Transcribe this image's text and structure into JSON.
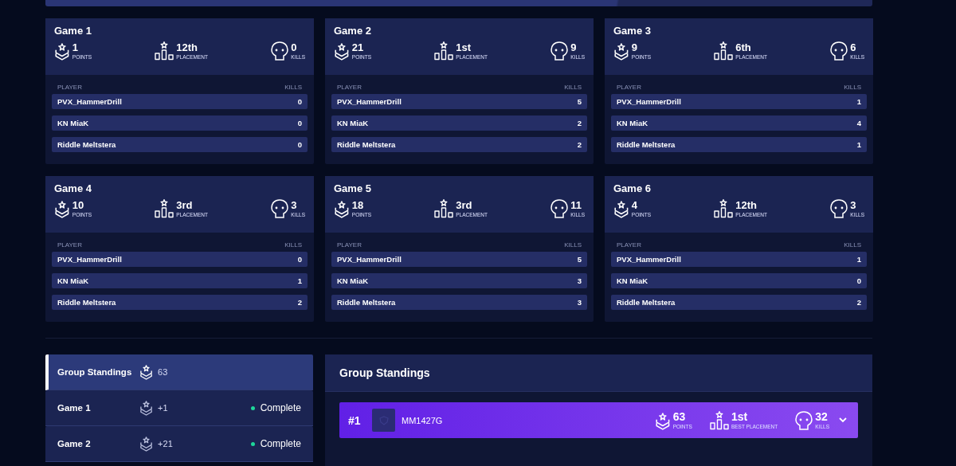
{
  "games": [
    {
      "title": "Game 1",
      "stats": [
        {
          "kind": "points",
          "value": "1",
          "label": "POINTS"
        },
        {
          "kind": "placement",
          "value": "12th",
          "label": "PLACEMENT"
        },
        {
          "kind": "kills",
          "value": "0",
          "label": "KILLS"
        }
      ],
      "columns": [
        "PLAYER",
        "KILLS"
      ],
      "rows": [
        {
          "player": "PVX_HammerDrill",
          "kills": "0"
        },
        {
          "player": "KN MiaK",
          "kills": "0"
        },
        {
          "player": "Riddle Meltstera",
          "kills": "0"
        }
      ]
    },
    {
      "title": "Game 2",
      "stats": [
        {
          "kind": "points",
          "value": "21",
          "label": "POINTS"
        },
        {
          "kind": "placement",
          "value": "1st",
          "label": "PLACEMENT"
        },
        {
          "kind": "kills",
          "value": "9",
          "label": "KILLS"
        }
      ],
      "columns": [
        "PLAYER",
        "KILLS"
      ],
      "rows": [
        {
          "player": "PVX_HammerDrill",
          "kills": "5"
        },
        {
          "player": "KN MiaK",
          "kills": "2"
        },
        {
          "player": "Riddle Meltstera",
          "kills": "2"
        }
      ]
    },
    {
      "title": "Game 3",
      "stats": [
        {
          "kind": "points",
          "value": "9",
          "label": "POINTS"
        },
        {
          "kind": "placement",
          "value": "6th",
          "label": "PLACEMENT"
        },
        {
          "kind": "kills",
          "value": "6",
          "label": "KILLS"
        }
      ],
      "columns": [
        "PLAYER",
        "KILLS"
      ],
      "rows": [
        {
          "player": "PVX_HammerDrill",
          "kills": "1"
        },
        {
          "player": "KN MiaK",
          "kills": "4"
        },
        {
          "player": "Riddle Meltstera",
          "kills": "1"
        }
      ]
    },
    {
      "title": "Game 4",
      "stats": [
        {
          "kind": "points",
          "value": "10",
          "label": "POINTS"
        },
        {
          "kind": "placement",
          "value": "3rd",
          "label": "PLACEMENT"
        },
        {
          "kind": "kills",
          "value": "3",
          "label": "KILLS"
        }
      ],
      "columns": [
        "PLAYER",
        "KILLS"
      ],
      "rows": [
        {
          "player": "PVX_HammerDrill",
          "kills": "0"
        },
        {
          "player": "KN MiaK",
          "kills": "1"
        },
        {
          "player": "Riddle Meltstera",
          "kills": "2"
        }
      ]
    },
    {
      "title": "Game 5",
      "stats": [
        {
          "kind": "points",
          "value": "18",
          "label": "POINTS"
        },
        {
          "kind": "placement",
          "value": "3rd",
          "label": "PLACEMENT"
        },
        {
          "kind": "kills",
          "value": "11",
          "label": "KILLS"
        }
      ],
      "columns": [
        "PLAYER",
        "KILLS"
      ],
      "rows": [
        {
          "player": "PVX_HammerDrill",
          "kills": "5"
        },
        {
          "player": "KN MiaK",
          "kills": "3"
        },
        {
          "player": "Riddle Meltstera",
          "kills": "3"
        }
      ]
    },
    {
      "title": "Game 6",
      "stats": [
        {
          "kind": "points",
          "value": "4",
          "label": "POINTS"
        },
        {
          "kind": "placement",
          "value": "12th",
          "label": "PLACEMENT"
        },
        {
          "kind": "kills",
          "value": "3",
          "label": "KILLS"
        }
      ],
      "columns": [
        "PLAYER",
        "KILLS"
      ],
      "rows": [
        {
          "player": "PVX_HammerDrill",
          "kills": "1"
        },
        {
          "player": "KN MiaK",
          "kills": "0"
        },
        {
          "player": "Riddle Meltstera",
          "kills": "2"
        }
      ]
    }
  ],
  "standings_nav": {
    "items": [
      {
        "kind": "summary",
        "label": "Group Standings",
        "points": "63",
        "selected": true
      },
      {
        "kind": "game",
        "label": "Game 1",
        "points": "+1",
        "status": "Complete",
        "color": "#1ed79a",
        "selected": false
      },
      {
        "kind": "game",
        "label": "Game 2",
        "points": "+21",
        "status": "Complete",
        "color": "#1ed79a",
        "selected": false
      }
    ]
  },
  "standings_panel": {
    "title": "Group Standings",
    "teams": [
      {
        "rank": "#1",
        "name": "MM1427G",
        "expanded": false,
        "stats": [
          {
            "kind": "points",
            "value": "63",
            "label": "POINTS"
          },
          {
            "kind": "placement",
            "value": "1st",
            "label": "BEST PLACEMENT"
          },
          {
            "kind": "kills",
            "value": "32",
            "label": "KILLS"
          }
        ]
      }
    ]
  }
}
